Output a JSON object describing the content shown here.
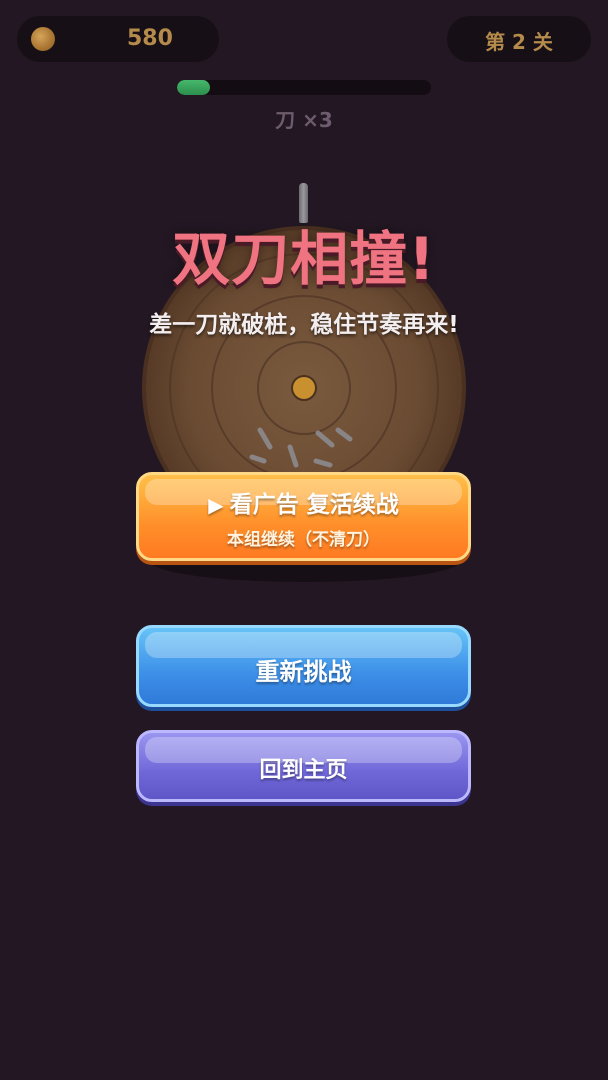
{
  "hud": {
    "coins": "580",
    "level": "第 2 关",
    "progress": 0.13,
    "knife_count": "刀 ×3"
  },
  "result": {
    "title": "双刀相撞!",
    "subtitle": "差一刀就破桩，稳住节奏再来!"
  },
  "buttons": {
    "revive_icon": "▶",
    "revive_label": "看广告 复活续战",
    "revive_sub": "本组继续（不清刀）",
    "retry_label": "重新挑战",
    "home_label": "回到主页"
  },
  "colors": {
    "background": "#221722",
    "title": "#f07381",
    "revive": "#ff8f2a",
    "retry": "#3d8fe8",
    "home": "#6f67d8",
    "progress": "#3fae63"
  },
  "icons": {
    "coin": "coin-icon",
    "knife": "knife-icon",
    "play": "play-icon"
  }
}
